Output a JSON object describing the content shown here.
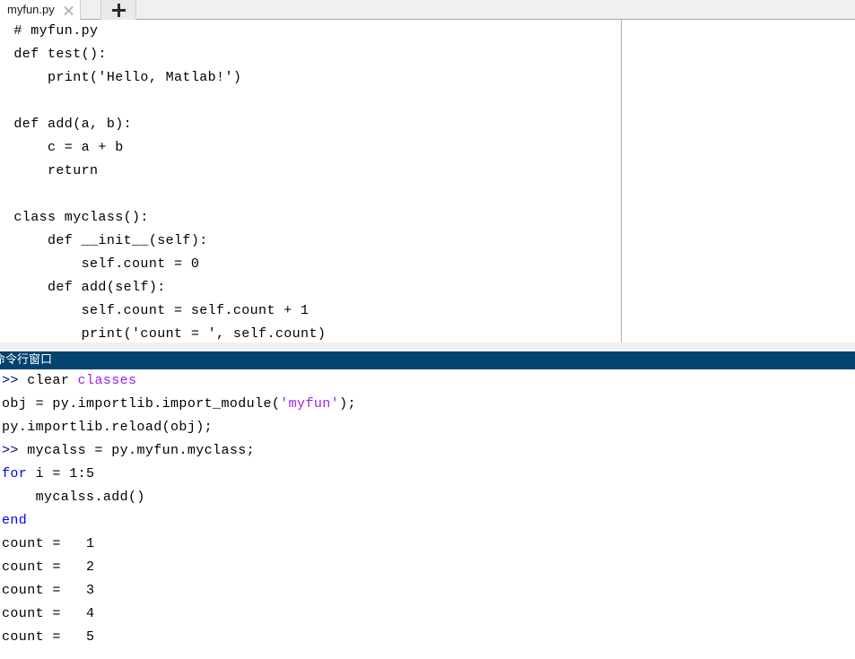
{
  "editor": {
    "tab": {
      "label": "myfun.py",
      "close_icon": "close-icon",
      "new_tab_icon": "plus-icon"
    },
    "code_lines": [
      " # myfun.py",
      " def test():",
      "     print('Hello, Matlab!')",
      "",
      " def add(a, b):",
      "     c = a + b",
      "     return",
      "",
      " class myclass():",
      "     def __init__(self):",
      "         self.count = 0",
      "     def add(self):",
      "         self.count = self.count + 1",
      "         print('count = ', self.count)"
    ]
  },
  "command_window": {
    "title": "命令行窗口",
    "lines": [
      [
        {
          "text": ">> ",
          "style": "prompt"
        },
        {
          "text": "clear ",
          "style": "plain"
        },
        {
          "text": "classes",
          "style": "string"
        }
      ],
      [
        {
          "text": "obj = py.importlib.import_module(",
          "style": "plain"
        },
        {
          "text": "'myfun'",
          "style": "string"
        },
        {
          "text": ");",
          "style": "plain"
        }
      ],
      [
        {
          "text": "py.importlib.reload(obj);",
          "style": "plain"
        }
      ],
      [
        {
          "text": ">> ",
          "style": "prompt"
        },
        {
          "text": "mycalss = py.myfun.myclass;",
          "style": "plain"
        }
      ],
      [
        {
          "text": "for",
          "style": "keyword"
        },
        {
          "text": " i = 1:5",
          "style": "plain"
        }
      ],
      [
        {
          "text": "    mycalss.add()",
          "style": "plain"
        }
      ],
      [
        {
          "text": "end",
          "style": "keyword"
        }
      ],
      [
        {
          "text": "count =   1",
          "style": "plain"
        }
      ],
      [
        {
          "text": "count =   2",
          "style": "plain"
        }
      ],
      [
        {
          "text": "count =   3",
          "style": "plain"
        }
      ],
      [
        {
          "text": "count =   4",
          "style": "plain"
        }
      ],
      [
        {
          "text": "count =   5",
          "style": "plain"
        }
      ]
    ]
  },
  "colors": {
    "titlebar_blue": "#02436f",
    "keyword_blue": "#0000ff",
    "string_purple": "#a020f0",
    "prompt_navy": "#000080",
    "tabbar_grey": "#f0f0f0",
    "divider_grey": "#b0b0b0"
  }
}
